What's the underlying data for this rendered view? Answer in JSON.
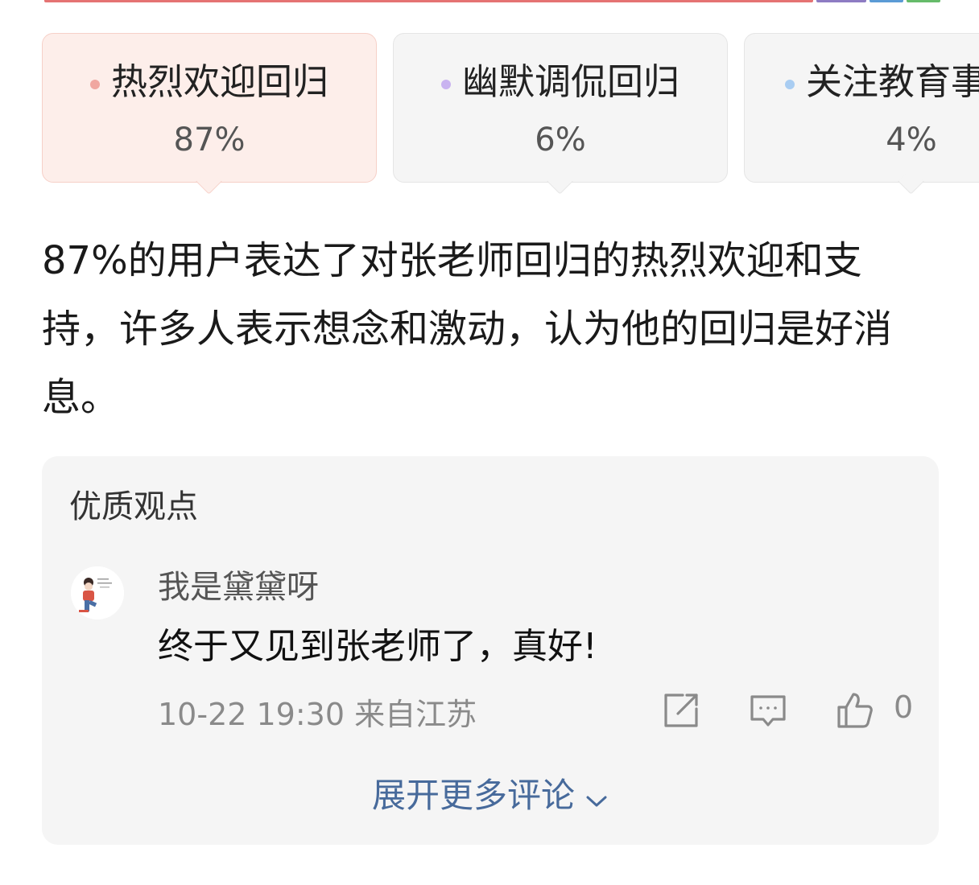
{
  "colors": {
    "strip_red": "#e57373",
    "strip_purple": "#8e7cc3",
    "strip_blue": "#5b9bd5",
    "strip_green": "#66bb6a",
    "dot_pink": "#f0a7a0",
    "dot_purple": "#c9b3f0",
    "dot_blue": "#a9cdf2",
    "link_blue": "#476a9b"
  },
  "opinions": [
    {
      "label": "热烈欢迎回归",
      "percent": "87%",
      "dot_color": "#f0a7a0",
      "selected": true
    },
    {
      "label": "幽默调侃回归",
      "percent": "6%",
      "dot_color": "#c9b3f0",
      "selected": false
    },
    {
      "label": "关注教育事",
      "percent": "4%",
      "dot_color": "#a9cdf2",
      "selected": false
    }
  ],
  "summary": "87%的用户表达了对张老师回归的热烈欢迎和支持，许多人表示想念和激动，认为他的回归是好消息。",
  "quality": {
    "title": "优质观点",
    "comment": {
      "username": "我是黛黛呀",
      "text": "终于又见到张老师了，真好!",
      "meta": "10-22 19:30 来自江苏",
      "likes": "0",
      "icons": [
        "share-icon",
        "comment-icon",
        "like-icon"
      ]
    },
    "expand_label": "展开更多评论"
  }
}
